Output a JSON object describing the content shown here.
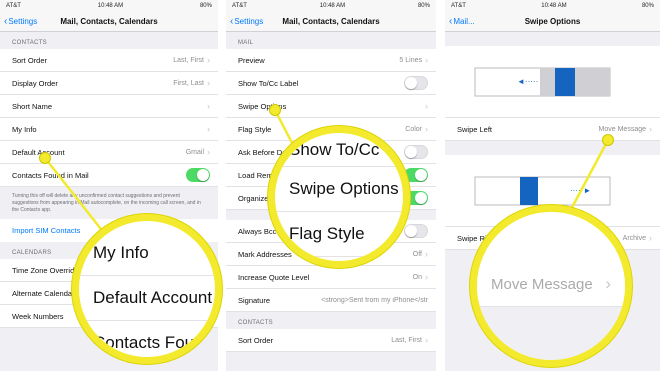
{
  "status": {
    "carrier": "AT&T",
    "time": "10:48 AM",
    "battery": "80%"
  },
  "panel1": {
    "back_label": "Settings",
    "title": "Mail, Contacts, Calendars",
    "section_contacts": "CONTACTS",
    "rows": [
      {
        "label": "Sort Order",
        "value": "Last, First"
      },
      {
        "label": "Display Order",
        "value": "First, Last"
      },
      {
        "label": "Short Name",
        "value": ""
      },
      {
        "label": "My Info",
        "value": ""
      },
      {
        "label": "Default Account",
        "value": "Gmail"
      },
      {
        "label": "Contacts Found in Mail",
        "value": ""
      }
    ],
    "note": "Turning this off will delete any unconfirmed contact suggestions and prevent suggestions from appearing in Mail autocomplete, on the incoming call screen, and in the Contacts app.",
    "import_sim": "Import SIM Contacts",
    "section_calendars": "CALENDARS",
    "cal_rows": [
      {
        "label": "Time Zone Override"
      },
      {
        "label": "Alternate Calendars"
      },
      {
        "label": "Week Numbers"
      }
    ],
    "zoom_items": [
      "My Info",
      "Default Account",
      "Contacts Found"
    ]
  },
  "panel2": {
    "back_label": "Settings",
    "title": "Mail, Contacts, Calendars",
    "section_mail": "MAIL",
    "rows": [
      {
        "label": "Preview",
        "value": "5 Lines"
      },
      {
        "label": "Show To/Cc Label",
        "value": ""
      },
      {
        "label": "Swipe Options",
        "value": ""
      },
      {
        "label": "Flag Style",
        "value": "Color"
      },
      {
        "label": "Ask Before Deleting",
        "value": ""
      },
      {
        "label": "Load Remote Images",
        "value": ""
      },
      {
        "label": "Organize by Thread",
        "value": ""
      }
    ],
    "rows2": [
      {
        "label": "Always Bcc Myself",
        "value": ""
      },
      {
        "label": "Mark Addresses",
        "value": "Off"
      },
      {
        "label": "Increase Quote Level",
        "value": "On"
      },
      {
        "label": "Signature",
        "value": "<strong>Sent from my iPhone</str"
      }
    ],
    "section_contacts": "CONTACTS",
    "sort_order": {
      "label": "Sort Order",
      "value": "Last, First"
    },
    "zoom_items": [
      "Show To/Cc",
      "Swipe Options",
      "Flag Style"
    ]
  },
  "panel3": {
    "back_label": "Mail...",
    "title": "Swipe Options",
    "swipe_left": {
      "label": "Swipe Left",
      "value": "Move Message"
    },
    "swipe_right": {
      "label": "Swipe Right",
      "value": "Archive"
    },
    "zoom_item": "Move Message"
  },
  "colors": {
    "accent": "#007aff",
    "highlight": "#f3ea2d",
    "toggle_on": "#4cd964"
  }
}
